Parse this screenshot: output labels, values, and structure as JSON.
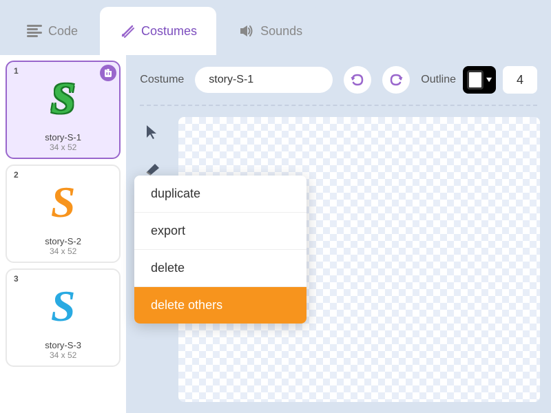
{
  "tabs": [
    {
      "id": "code",
      "label": "Code",
      "icon": "≡",
      "active": false
    },
    {
      "id": "costumes",
      "label": "Costumes",
      "icon": "✏",
      "active": true
    },
    {
      "id": "sounds",
      "label": "Sounds",
      "icon": "🔊",
      "active": false
    }
  ],
  "costumes": [
    {
      "number": "1",
      "name": "story-S-1",
      "size": "34 x 52",
      "selected": true,
      "colorClass": "s-letter-1",
      "letter": "S"
    },
    {
      "number": "2",
      "name": "story-S-2",
      "size": "34 x 52",
      "selected": false,
      "colorClass": "s-letter-2",
      "letter": "S"
    },
    {
      "number": "3",
      "name": "story-S-3",
      "size": "34 x 52",
      "selected": false,
      "colorClass": "s-letter-3",
      "letter": "S"
    }
  ],
  "toolbar": {
    "costume_label": "Costume",
    "costume_name": "story-S-1",
    "outline_label": "Outline",
    "outline_value": "4",
    "undo_label": "↩",
    "redo_label": "↪"
  },
  "context_menu": {
    "items": [
      {
        "id": "duplicate",
        "label": "duplicate",
        "special": false
      },
      {
        "id": "export",
        "label": "export",
        "special": false
      },
      {
        "id": "delete",
        "label": "delete",
        "special": false
      },
      {
        "id": "delete-others",
        "label": "delete others",
        "special": true
      }
    ]
  },
  "tools": [
    {
      "id": "select",
      "icon": "↖",
      "label": "select tool"
    },
    {
      "id": "eraser",
      "icon": "◆",
      "label": "eraser tool"
    }
  ],
  "colors": {
    "active_tab_bg": "#ffffff",
    "inactive_tab_bg": "#d9e3f0",
    "accent_purple": "#9966cc",
    "delete_others_bg": "#f7941d",
    "costume1_color": "#3ab54a",
    "costume2_color": "#f7941d",
    "costume3_color": "#29aae2"
  }
}
